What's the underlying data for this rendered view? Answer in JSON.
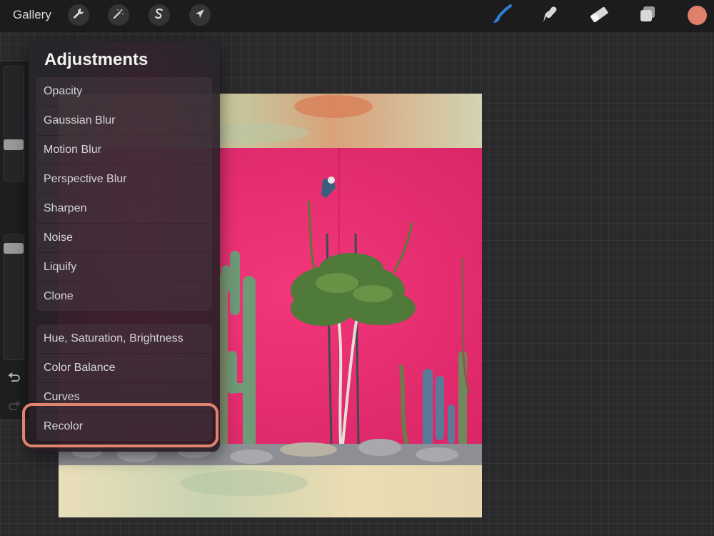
{
  "topbar": {
    "gallery_label": "Gallery",
    "left_tools": [
      "wrench-icon",
      "magic-wand-icon",
      "selection-s-icon",
      "transform-arrow-icon"
    ],
    "right_tools": [
      "brush-icon",
      "smudge-icon",
      "eraser-icon",
      "layers-icon"
    ],
    "active_tool": "brush-icon",
    "current_color": "#e0806a",
    "brush_color": "#2f7fd8"
  },
  "sidebar": {
    "controls": [
      "brush-size-slider",
      "modify-button",
      "opacity-slider",
      "undo-icon",
      "redo-icon"
    ]
  },
  "adjustments": {
    "title": "Adjustments",
    "group1": [
      "Opacity",
      "Gaussian Blur",
      "Motion Blur",
      "Perspective Blur",
      "Sharpen",
      "Noise",
      "Liquify",
      "Clone"
    ],
    "group2": [
      "Hue, Saturation, Brightness",
      "Color Balance",
      "Curves",
      "Recolor"
    ],
    "highlighted": "Recolor",
    "highlight_color": "#e0846f"
  },
  "canvas": {
    "wall_color": "#ea2f6f",
    "border_color": "#e8dcb8"
  }
}
